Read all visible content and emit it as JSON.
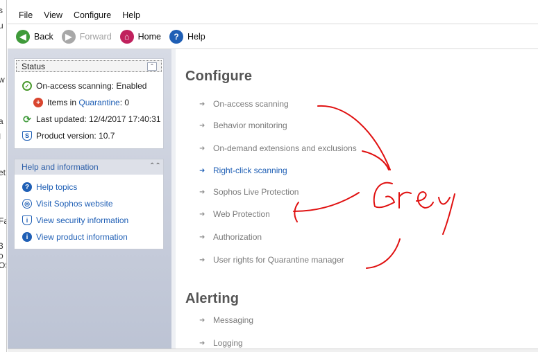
{
  "menu": [
    "File",
    "View",
    "Configure",
    "Help"
  ],
  "toolbar": {
    "back": "Back",
    "forward": "Forward",
    "home": "Home",
    "help": "Help"
  },
  "status": {
    "title": "Status",
    "on_access": "On-access scanning: Enabled",
    "items_prefix": "Items in ",
    "quarantine_link": "Quarantine",
    "items_suffix": ": 0",
    "last_updated": "Last updated: 12/4/2017 17:40:31",
    "product_version": "Product version: 10.7"
  },
  "help_panel": {
    "title": "Help and information",
    "links": [
      "Help topics",
      "Visit Sophos website",
      "View security information",
      "View product information"
    ]
  },
  "configure": {
    "title": "Configure",
    "items": [
      "On-access scanning",
      "Behavior monitoring",
      "On-demand extensions and exclusions",
      "Right-click scanning",
      "Sophos Live Protection",
      "Web Protection",
      "Authorization",
      "User rights for Quarantine manager"
    ]
  },
  "alerting": {
    "title": "Alerting",
    "items": [
      "Messaging",
      "Logging"
    ]
  },
  "annotation": {
    "text": "Grey",
    "color": "#e01010"
  },
  "left_strip": [
    "s",
    "u",
    "w",
    "a",
    "I",
    "et",
    "Fa",
    "3",
    "o",
    "OS"
  ]
}
